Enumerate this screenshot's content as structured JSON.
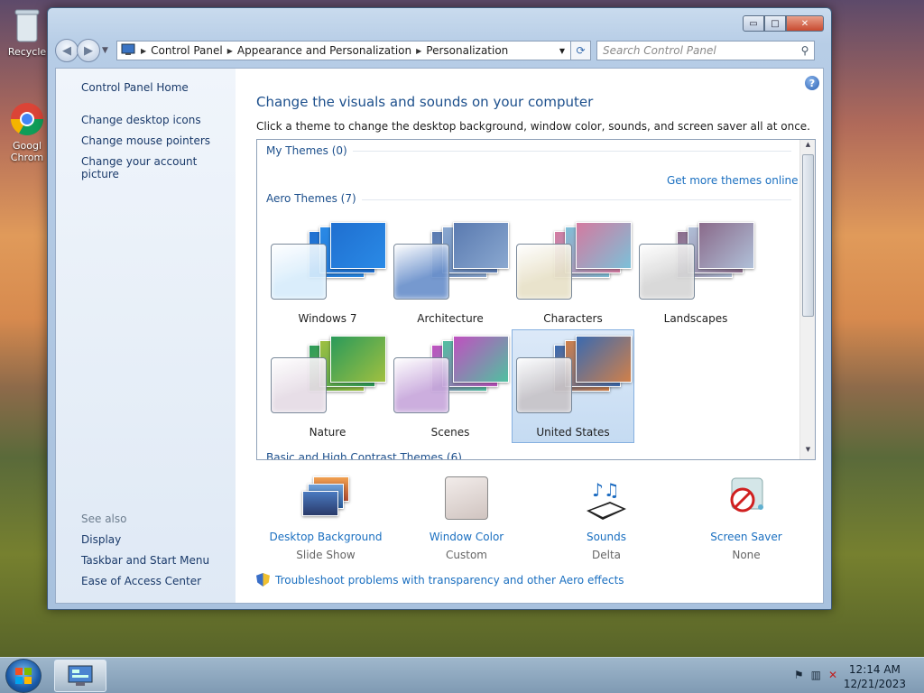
{
  "desktop": {
    "icons": [
      {
        "label": "Recycle",
        "icon": "recycle-bin-icon"
      },
      {
        "label": "Googl Chrom",
        "icon": "chrome-icon"
      }
    ]
  },
  "window": {
    "caption_buttons": {
      "minimize": "▭",
      "maximize": "□",
      "close": "✕"
    },
    "address": {
      "crumbs": [
        "Control Panel",
        "Appearance and Personalization",
        "Personalization"
      ]
    },
    "search": {
      "placeholder": "Search Control Panel"
    },
    "help": "?"
  },
  "sidebar": {
    "home": "Control Panel Home",
    "links": [
      "Change desktop icons",
      "Change mouse pointers",
      "Change your account picture"
    ],
    "see_also_label": "See also",
    "see_also": [
      "Display",
      "Taskbar and Start Menu",
      "Ease of Access Center"
    ]
  },
  "main": {
    "title": "Change the visuals and sounds on your computer",
    "subtitle": "Click a theme to change the desktop background, window color, sounds, and screen saver all at once.",
    "groups": {
      "my_themes": "My Themes (0)",
      "aero_themes": "Aero Themes (7)",
      "basic_themes": "Basic and High Contrast Themes (6)",
      "more_link": "Get more themes online"
    },
    "themes": [
      {
        "name": "Windows 7",
        "selected": false,
        "colors": [
          "#1f6fd0",
          "#2a8ae6"
        ],
        "tint": "#d7ecfb"
      },
      {
        "name": "Architecture",
        "selected": false,
        "colors": [
          "#5a7ab0",
          "#8aa8d0"
        ],
        "tint": "#6b91cc"
      },
      {
        "name": "Characters",
        "selected": false,
        "colors": [
          "#d47aa0",
          "#7cc0d8"
        ],
        "tint": "#e8e1c8"
      },
      {
        "name": "Landscapes",
        "selected": false,
        "colors": [
          "#8a6a8a",
          "#b0c0d8"
        ],
        "tint": "#d6d6d6"
      },
      {
        "name": "Nature",
        "selected": false,
        "colors": [
          "#2a9a5a",
          "#a0c040"
        ],
        "tint": "#e6dce6"
      },
      {
        "name": "Scenes",
        "selected": false,
        "colors": [
          "#c050c0",
          "#50c0a0"
        ],
        "tint": "#c8a8dc"
      },
      {
        "name": "United States",
        "selected": true,
        "colors": [
          "#3a6ab0",
          "#d0804a"
        ],
        "tint": "#c8c4c8"
      }
    ]
  },
  "bottom": [
    {
      "label": "Desktop Background",
      "value": "Slide Show",
      "icon": "desktop-background-icon"
    },
    {
      "label": "Window Color",
      "value": "Custom",
      "icon": "window-color-icon"
    },
    {
      "label": "Sounds",
      "value": "Delta",
      "icon": "sounds-icon"
    },
    {
      "label": "Screen Saver",
      "value": "None",
      "icon": "screen-saver-icon"
    }
  ],
  "troubleshoot": "Troubleshoot problems with transparency and other Aero effects",
  "taskbar": {
    "time": "12:14 AM",
    "date": "12/21/2023"
  }
}
